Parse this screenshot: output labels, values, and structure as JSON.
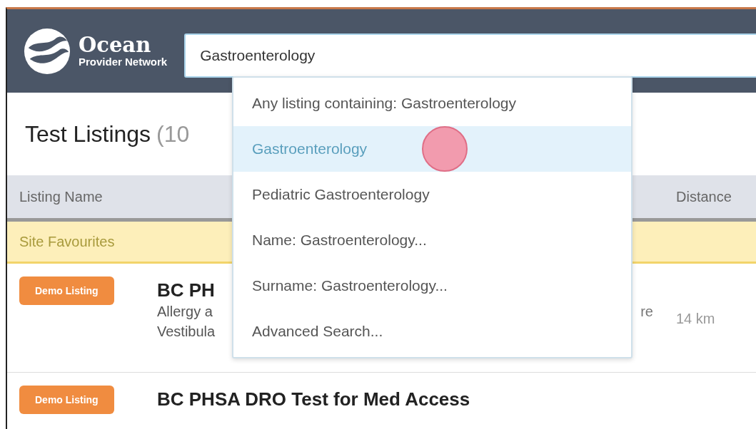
{
  "header": {
    "logo_title": "Ocean",
    "logo_subtitle": "Provider Network",
    "search": {
      "value": "Gastroenterology"
    }
  },
  "suggestions": [
    {
      "label": "Any listing containing: Gastroenterology",
      "selected": false
    },
    {
      "label": "Gastroenterology",
      "selected": true
    },
    {
      "label": "Pediatric Gastroenterology",
      "selected": false
    },
    {
      "label": "Name: Gastroenterology...",
      "selected": false
    },
    {
      "label": "Surname: Gastroenterology...",
      "selected": false
    },
    {
      "label": "Advanced Search...",
      "selected": false
    }
  ],
  "page": {
    "title": "Test Listings",
    "count": "(10"
  },
  "table": {
    "columns": [
      "Listing Name",
      "Distance"
    ],
    "group": "Site Favourites",
    "rows": [
      {
        "badge": "Demo Listing",
        "name": "BC PH",
        "description_lines": [
          "Allergy a",
          "Vestibula"
        ],
        "description_tail": "re",
        "distance": "14 km"
      },
      {
        "badge": "Demo Listing",
        "name": "BC PHSA DRO Test for Med Access",
        "description_lines": [],
        "description_tail": "",
        "distance": ""
      }
    ]
  }
}
